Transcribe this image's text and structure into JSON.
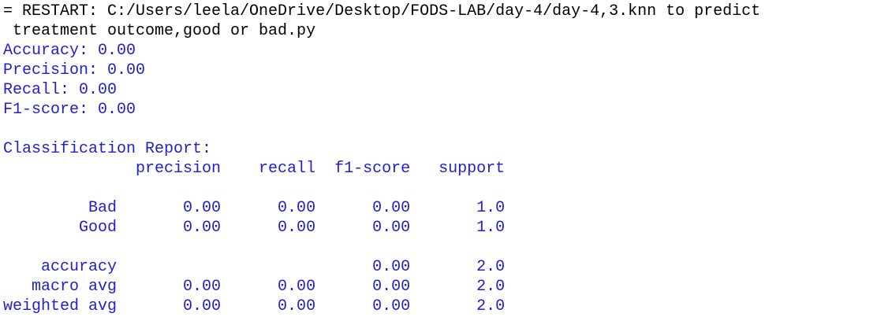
{
  "shell": {
    "restart_line_1": "= RESTART: C:/Users/leela/OneDrive/Desktop/FODS-LAB/day-4/day-4,3.knn to predict",
    "restart_line_2": " treatment outcome,good or bad.py",
    "metrics": [
      "Accuracy: 0.00",
      "Precision: 0.00",
      "Recall: 0.00",
      "F1-score: 0.00"
    ],
    "report": {
      "title": "Classification Report:",
      "header": "              precision    recall  f1-score   support",
      "rows": [
        "         Bad       0.00      0.00      0.00       1.0",
        "        Good       0.00      0.00      0.00       1.0",
        "    accuracy                           0.00       2.0",
        "   macro avg       0.00      0.00      0.00       2.0",
        "weighted avg       0.00      0.00      0.00       2.0"
      ]
    },
    "colors": {
      "output_text": "#1f1fd0",
      "restart_text": "#000000",
      "background": "#ffffff"
    }
  }
}
